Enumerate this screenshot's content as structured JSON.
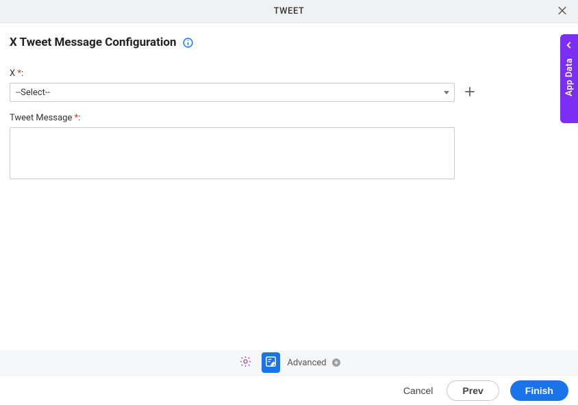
{
  "header": {
    "title": "TWEET"
  },
  "page": {
    "title": "X Tweet Message Configuration"
  },
  "form": {
    "x_field": {
      "label": "X",
      "selected": "--Select--"
    },
    "tweet_message": {
      "label": "Tweet Message",
      "value": ""
    }
  },
  "toolbar": {
    "advanced_label": "Advanced"
  },
  "footer": {
    "cancel_label": "Cancel",
    "prev_label": "Prev",
    "finish_label": "Finish"
  },
  "side_tab": {
    "label": "App Data"
  }
}
